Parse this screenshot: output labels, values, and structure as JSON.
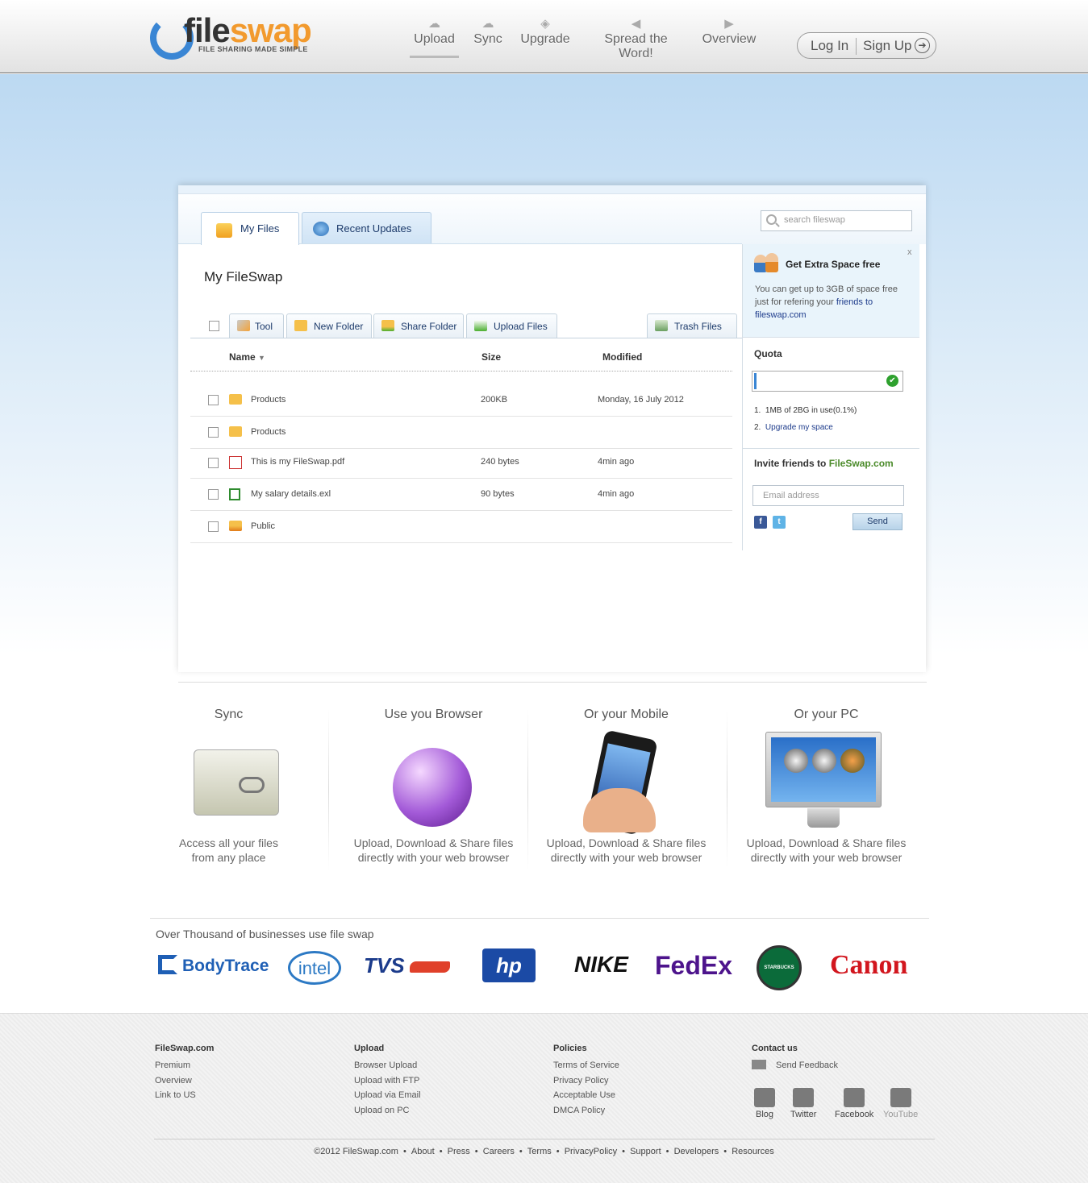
{
  "header": {
    "logo_a": "file",
    "logo_b": "swap",
    "tagline": "FILE SHARING MADE SIMPLE",
    "nav": [
      "Upload",
      "Sync",
      "Upgrade",
      "Spread the Word!",
      "Overview"
    ],
    "login": "Log In",
    "signup": "Sign Up"
  },
  "tabs": {
    "my_files": "My Files",
    "recent": "Recent Updates"
  },
  "search": {
    "placeholder": "search fileswap"
  },
  "page_title": "My FileSwap",
  "toolbar": {
    "tool": "Tool",
    "new_folder": "New Folder",
    "share_folder": "Share Folder",
    "upload_files": "Upload Files",
    "trash_files": "Trash Files"
  },
  "columns": {
    "name": "Name",
    "size": "Size",
    "modified": "Modified"
  },
  "files": [
    {
      "name": "Products",
      "size": "200KB",
      "modified": "Monday, 16 July 2012",
      "type": "folder"
    },
    {
      "name": "Products",
      "size": "",
      "modified": "",
      "type": "folder"
    },
    {
      "name": "This is my FileSwap.pdf",
      "size": "240 bytes",
      "modified": "4min ago",
      "type": "pdf"
    },
    {
      "name": "My salary details.exl",
      "size": "90 bytes",
      "modified": "4min ago",
      "type": "excel"
    },
    {
      "name": "Public",
      "size": "",
      "modified": "",
      "type": "public-folder"
    }
  ],
  "promo": {
    "close": "x",
    "title": "Get Extra Space free",
    "text": "You can get up to 3GB of space free just for refering your ",
    "link": "friends to fileswap.com"
  },
  "quota": {
    "title": "Quota",
    "used_fraction": 0.001,
    "item1": "1MB of 2BG in use(0.1%)",
    "item2": "Upgrade my space"
  },
  "invite": {
    "title": "Invite friends to ",
    "brand": "FileSwap.com",
    "placeholder": "Email address",
    "send": "Send"
  },
  "features": [
    {
      "title": "Sync",
      "text1": "Access all your files",
      "text2": "from any place"
    },
    {
      "title": "Use you Browser",
      "text1": "Upload, Download & Share files",
      "text2": "directly with your web browser"
    },
    {
      "title": "Or your Mobile",
      "text1": "Upload, Download & Share files",
      "text2": "directly with your web browser"
    },
    {
      "title": "Or your  PC",
      "text1": "Upload, Download & Share files",
      "text2": "directly with your web browser"
    }
  ],
  "business": {
    "title": "Over Thousand of  businesses use file swap",
    "brands": [
      "BodyTrace",
      "intel",
      "TVS",
      "hp",
      "NIKE",
      "FedEx",
      "STARBUCKS COFFEE",
      "Canon"
    ]
  },
  "footer": {
    "col1": {
      "title": "FileSwap.com",
      "items": [
        "Premium",
        "Overview",
        "Link to US"
      ]
    },
    "col2": {
      "title": "Upload",
      "items": [
        "Browser Upload",
        "Upload with FTP",
        "Upload via Email",
        "Upload on PC"
      ]
    },
    "col3": {
      "title": "Policies",
      "items": [
        "Terms of Service",
        "Privacy Policy",
        "Acceptable Use",
        "DMCA Policy"
      ]
    },
    "col4": {
      "title": "Contact us",
      "feedback": "Send Feedback"
    },
    "social": [
      "Blog",
      "Twitter",
      "Facebook",
      "YouTube"
    ],
    "links": [
      "©2012 FileSwap.com",
      "About",
      "Press",
      "Careers",
      "Terms",
      "PrivacyPolicy",
      "Support",
      "Developers",
      "Resources"
    ]
  }
}
